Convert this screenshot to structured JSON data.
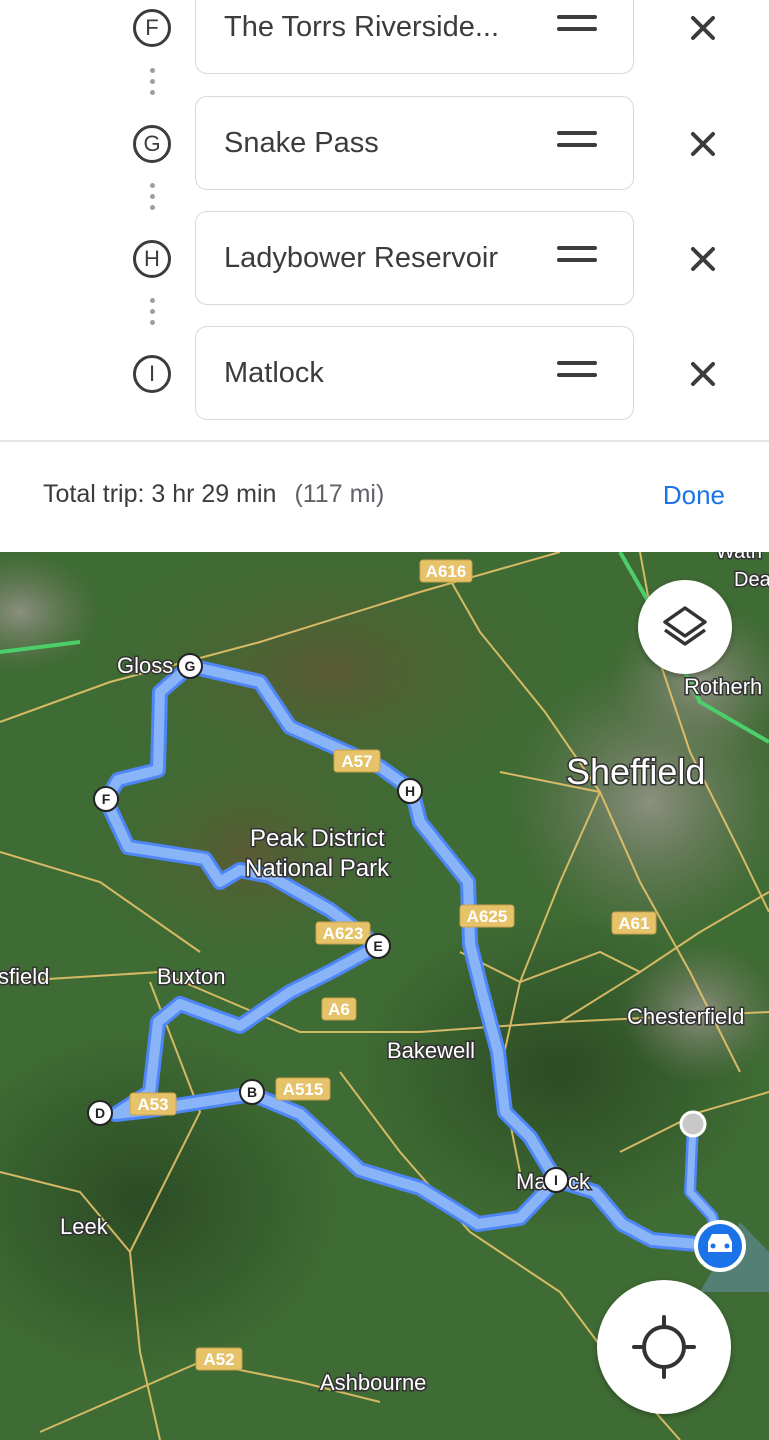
{
  "stops": [
    {
      "letter": "F",
      "name": "The Torrs Riverside..."
    },
    {
      "letter": "G",
      "name": "Snake Pass"
    },
    {
      "letter": "H",
      "name": "Ladybower Reservoir"
    },
    {
      "letter": "I",
      "name": "Matlock"
    }
  ],
  "summary": {
    "total": "Total trip: 3 hr 29 min",
    "distance": "(117 mi)",
    "done": "Done"
  },
  "map": {
    "places": {
      "sheffield": "Sheffield",
      "rotherham": "Rotherh",
      "chesterfield": "Chesterfield",
      "bakewell": "Bakewell",
      "buxton": "Buxton",
      "leek": "Leek",
      "ashbourne": "Ashbourne",
      "glossop": "Gloss",
      "matlock": "Ma",
      "matlock_end": "ck",
      "macclesfield": "sfield",
      "peak1": "Peak District",
      "peak2": "National Park",
      "wath": "Wath",
      "dea": "Dea"
    },
    "roads": {
      "a616": "A616",
      "a57": "A57",
      "a625": "A625",
      "a61": "A61",
      "a623": "A623",
      "a6": "A6",
      "a53": "A53",
      "a515": "A515",
      "a52": "A52"
    },
    "markers": {
      "b": "B",
      "d": "D",
      "e": "E",
      "f": "F",
      "g": "G",
      "h": "H",
      "i": "I"
    },
    "colors": {
      "route": "#8ab4f8",
      "route_border": "#4f86f7",
      "terrain": "#3f6b34",
      "roads": "#e6c36a"
    }
  }
}
